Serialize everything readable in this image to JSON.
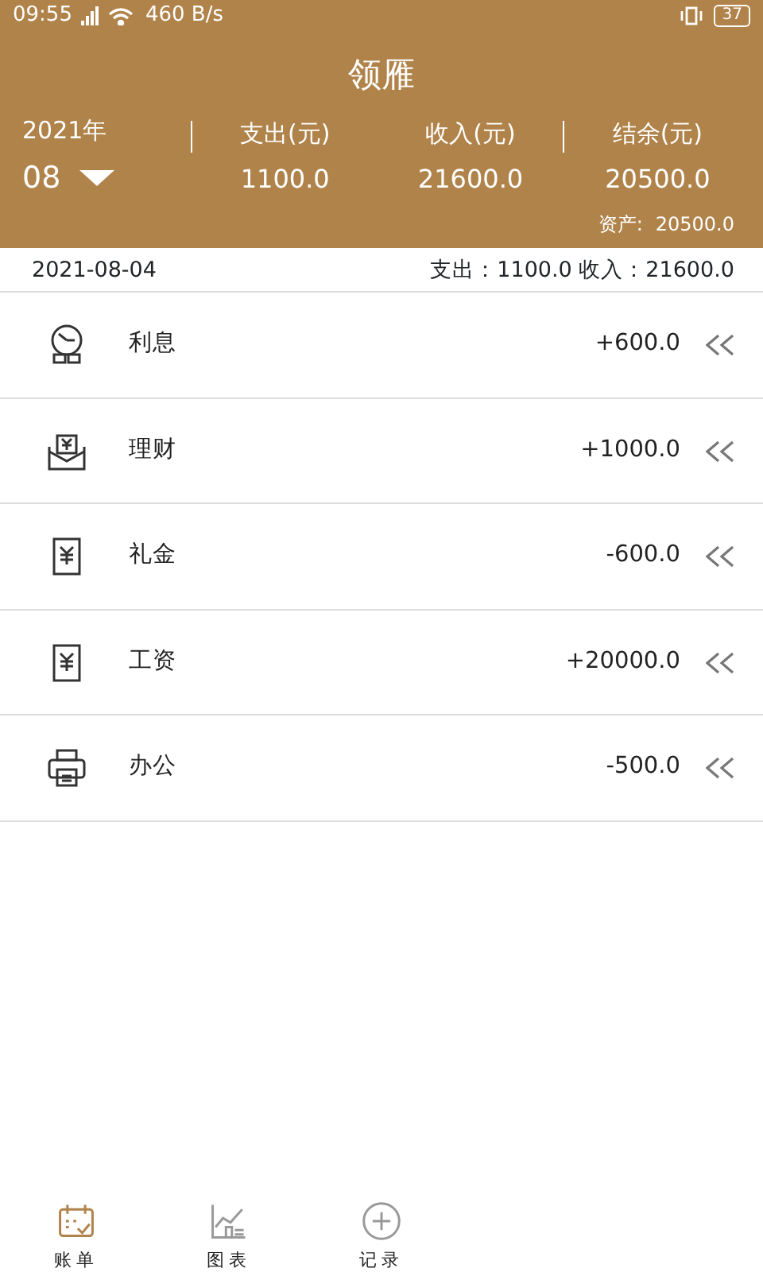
{
  "status_bar": {
    "time": "09:55",
    "network_speed": "460 B/s",
    "battery": "37"
  },
  "header": {
    "title": "领雁",
    "year": "2021年",
    "month": "08",
    "columns": [
      {
        "label": "支出(元)",
        "value": "1100.0"
      },
      {
        "label": "收入(元)",
        "value": "21600.0"
      },
      {
        "label": "结余(元)",
        "value": "20500.0"
      }
    ],
    "assets_label": "资产:",
    "assets_value": "20500.0"
  },
  "day": {
    "date": "2021-08-04",
    "summary": "支出：1100.0 收入：21600.0"
  },
  "entries": [
    {
      "kind": "interest",
      "name": "利息",
      "amount": "+600.0"
    },
    {
      "kind": "finance",
      "name": "理财",
      "amount": "+1000.0"
    },
    {
      "kind": "gift",
      "name": "礼金",
      "amount": "-600.0"
    },
    {
      "kind": "salary",
      "name": "工资",
      "amount": "+20000.0"
    },
    {
      "kind": "office",
      "name": "办公",
      "amount": "-500.0"
    }
  ],
  "tabs": [
    {
      "kind": "bill",
      "label": "账单",
      "selected": true
    },
    {
      "kind": "chart",
      "label": "图表",
      "selected": false
    },
    {
      "kind": "add",
      "label": "记录",
      "selected": false
    }
  ]
}
